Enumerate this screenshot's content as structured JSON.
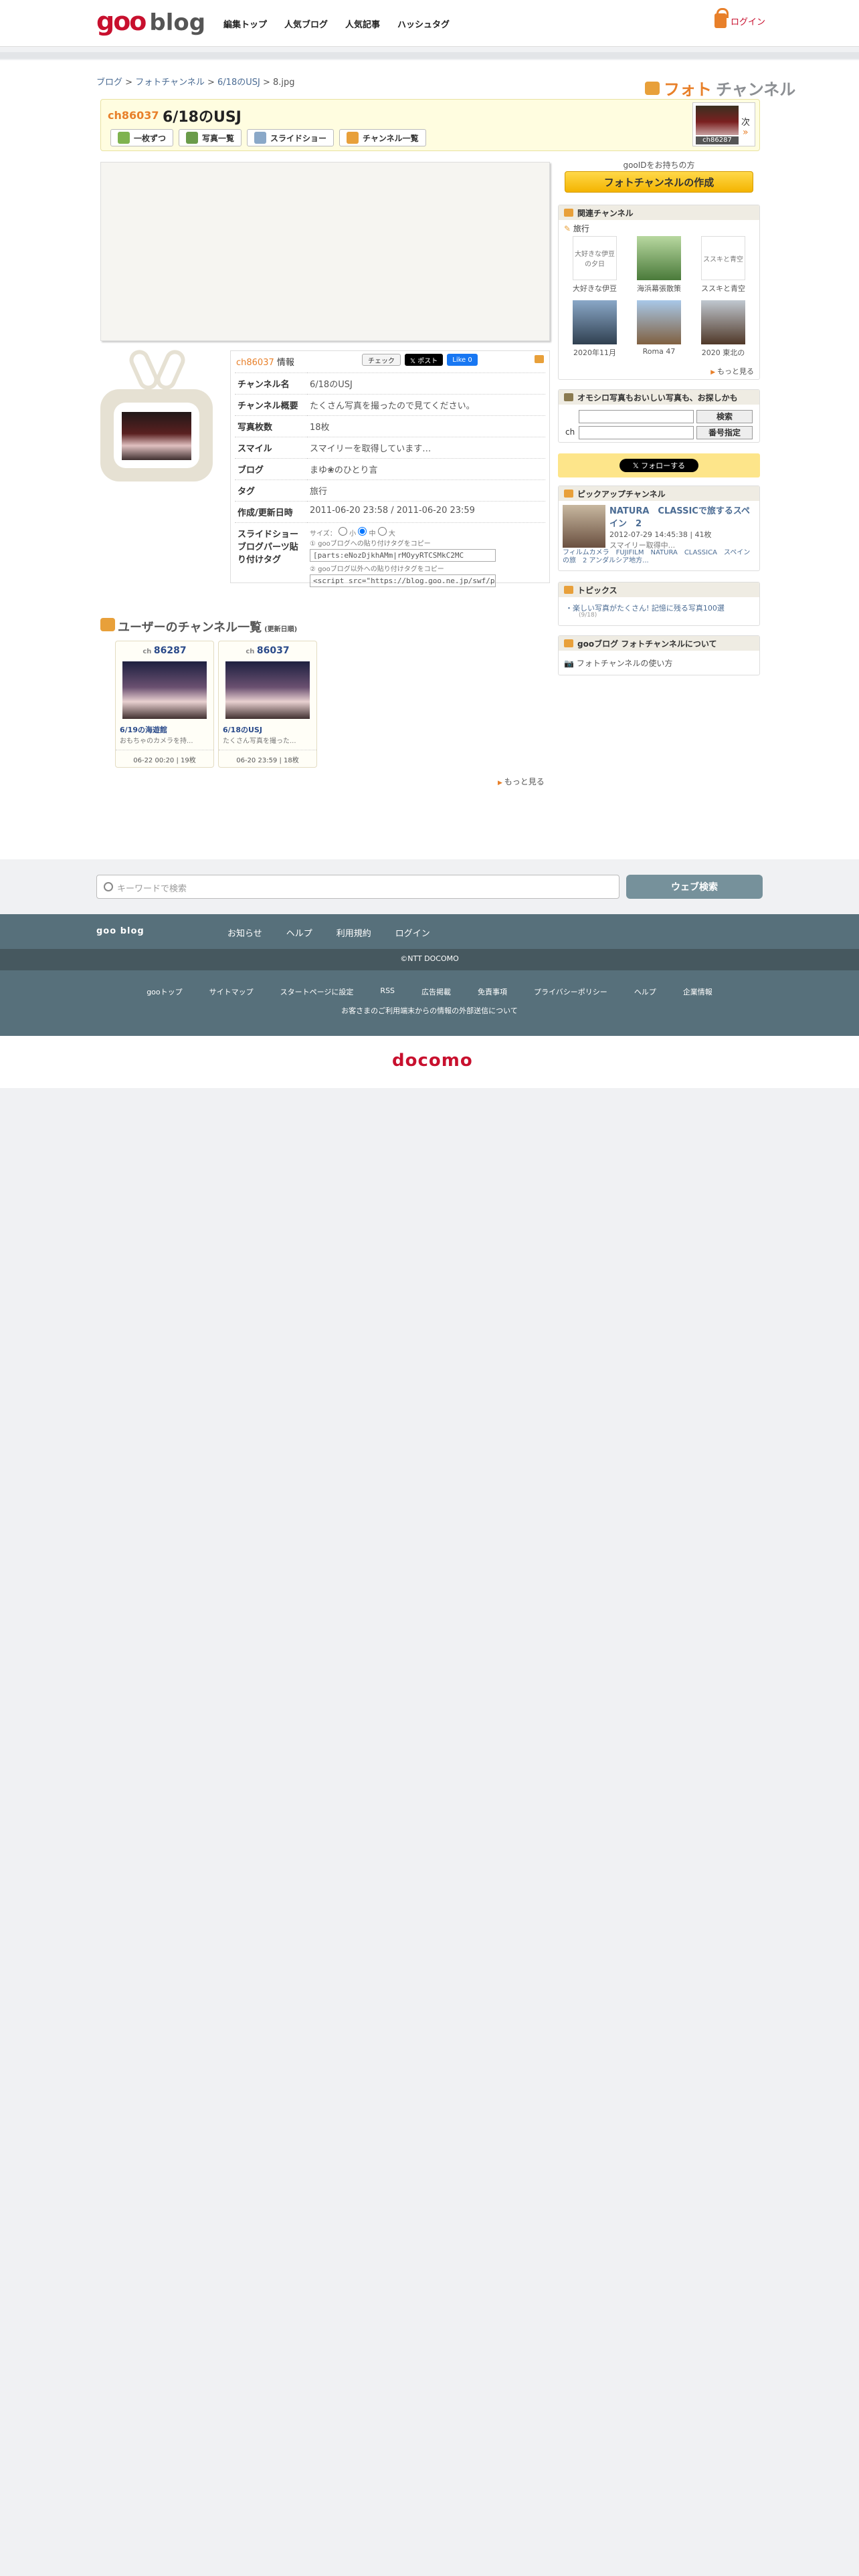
{
  "header": {
    "logo_goo": "goo",
    "logo_blog": "blog",
    "nav": [
      "編集トップ",
      "人気ブログ",
      "人気記事",
      "ハッシュタグ"
    ],
    "login": "ログイン"
  },
  "breadcrumb": {
    "items": [
      "ブログ",
      "フォトチャンネル",
      "6/18のUSJ"
    ],
    "current": "8.jpg",
    "sep": ">"
  },
  "brand": {
    "a": "フォト",
    "b": "チャンネル"
  },
  "channel": {
    "number": "ch86037",
    "title": "6/18のUSJ",
    "tools": [
      "一枚ずつ",
      "写真一覧",
      "スライドショー",
      "チャンネル一覧"
    ],
    "next_label": "次",
    "next_arrow": "»",
    "next_ch": "ch86287"
  },
  "info": {
    "header_ch": "ch86037",
    "header_label": " 情報",
    "check": "チェック",
    "post": "𝕏 ポスト",
    "like": "Like 0",
    "rows": [
      {
        "k": "チャンネル名",
        "v": "6/18のUSJ"
      },
      {
        "k": "チャンネル概要",
        "v": "たくさん写真を撮ったので見てください。"
      },
      {
        "k": "写真枚数",
        "v": "18枚"
      },
      {
        "k": "スマイル",
        "v": "スマイリーを取得しています…"
      },
      {
        "k": "ブログ",
        "v": "まゆ❀のひとり言"
      },
      {
        "k": "タグ",
        "v": "旅行"
      },
      {
        "k": "作成/更新日時",
        "v": "2011-06-20 23:58 / 2011-06-20 23:59"
      }
    ],
    "slide_k": "スライドショーブログパーツ貼り付けタグ",
    "size_label": "サイズ：",
    "size_s": "小",
    "size_m": "中",
    "size_l": "大",
    "copy1": "① gooブログへの貼り付けタグをコピー",
    "code1": "[parts:eNozDjkhAMm|rMOyyRTCSMkC2MC",
    "copy2": "② gooブログ以外への貼り付けタグをコピー",
    "code2": "<script src=\"https://blog.goo.ne.jp/swf/pl"
  },
  "user_channels": {
    "title": "ユーザーのチャンネル一覧",
    "sub": "(更新日順)",
    "cards": [
      {
        "ch": "86287",
        "title": "6/19の海遊館",
        "desc": "おもちゃのカメラを持...",
        "foot": "06-22 00:20 | 19枚"
      },
      {
        "ch": "86037",
        "title": "6/18のUSJ",
        "desc": "たくさん写真を撮った...",
        "foot": "06-20 23:59 | 18枚"
      }
    ],
    "more": "もっと見る"
  },
  "sidebar": {
    "goo_text": "gooIDをお持ちの方",
    "make_btn": "フォトチャンネルの作成",
    "related": {
      "title": "関連チャンネル",
      "tag": "旅行",
      "items": [
        {
          "label": "大好きな伊豆",
          "alt": "大好きな伊豆の夕日"
        },
        {
          "label": "海浜幕張散策",
          "alt": ""
        },
        {
          "label": "ススキと青空",
          "alt": "ススキと青空"
        },
        {
          "label": "2020年11月",
          "alt": ""
        },
        {
          "label": "Roma 47",
          "alt": ""
        },
        {
          "label": "2020 東北の",
          "alt": ""
        }
      ],
      "more": "もっと見る"
    },
    "search": {
      "title": "オモシロ写真もおいしい写真も、お探しかも",
      "search_btn": "検索",
      "ch_label": "ch",
      "num_btn": "番号指定"
    },
    "follow": "𝕏 フォローする",
    "pickup": {
      "title": "ピックアップチャンネル",
      "ch_title": "NATURA　CLASSICで旅するスペイン　2",
      "date": "2012-07-29 14:45:38 | 41枚",
      "desc": "スマイリー取得中...",
      "tags": "フィルムカメラ　FUJIFILM　NATURA　CLASSICA　スペインの旅　2 アンダルシア地方..."
    },
    "topics": {
      "title": "トピックス",
      "item": "楽しい写真がたくさん! 記憶に残る写真100選",
      "date": "(9/18)"
    },
    "about": {
      "title": "gooブログ フォトチャンネルについて",
      "item": "フォトチャンネルの使い方"
    }
  },
  "footer": {
    "search_placeholder": "キーワードで検索",
    "web_search": "ウェブ検索",
    "blog_label": "goo blog",
    "links1": [
      "お知らせ",
      "ヘルプ",
      "利用規約",
      "ログイン"
    ],
    "copyright": "©NTT DOCOMO",
    "links2": [
      "gooトップ",
      "サイトマップ",
      "スタートページに設定",
      "RSS",
      "広告掲載",
      "免責事項",
      "プライバシーポリシー",
      "ヘルプ",
      "企業情報"
    ],
    "notice": "お客さまのご利用端末からの情報の外部送信について",
    "docomo": "docomo"
  }
}
